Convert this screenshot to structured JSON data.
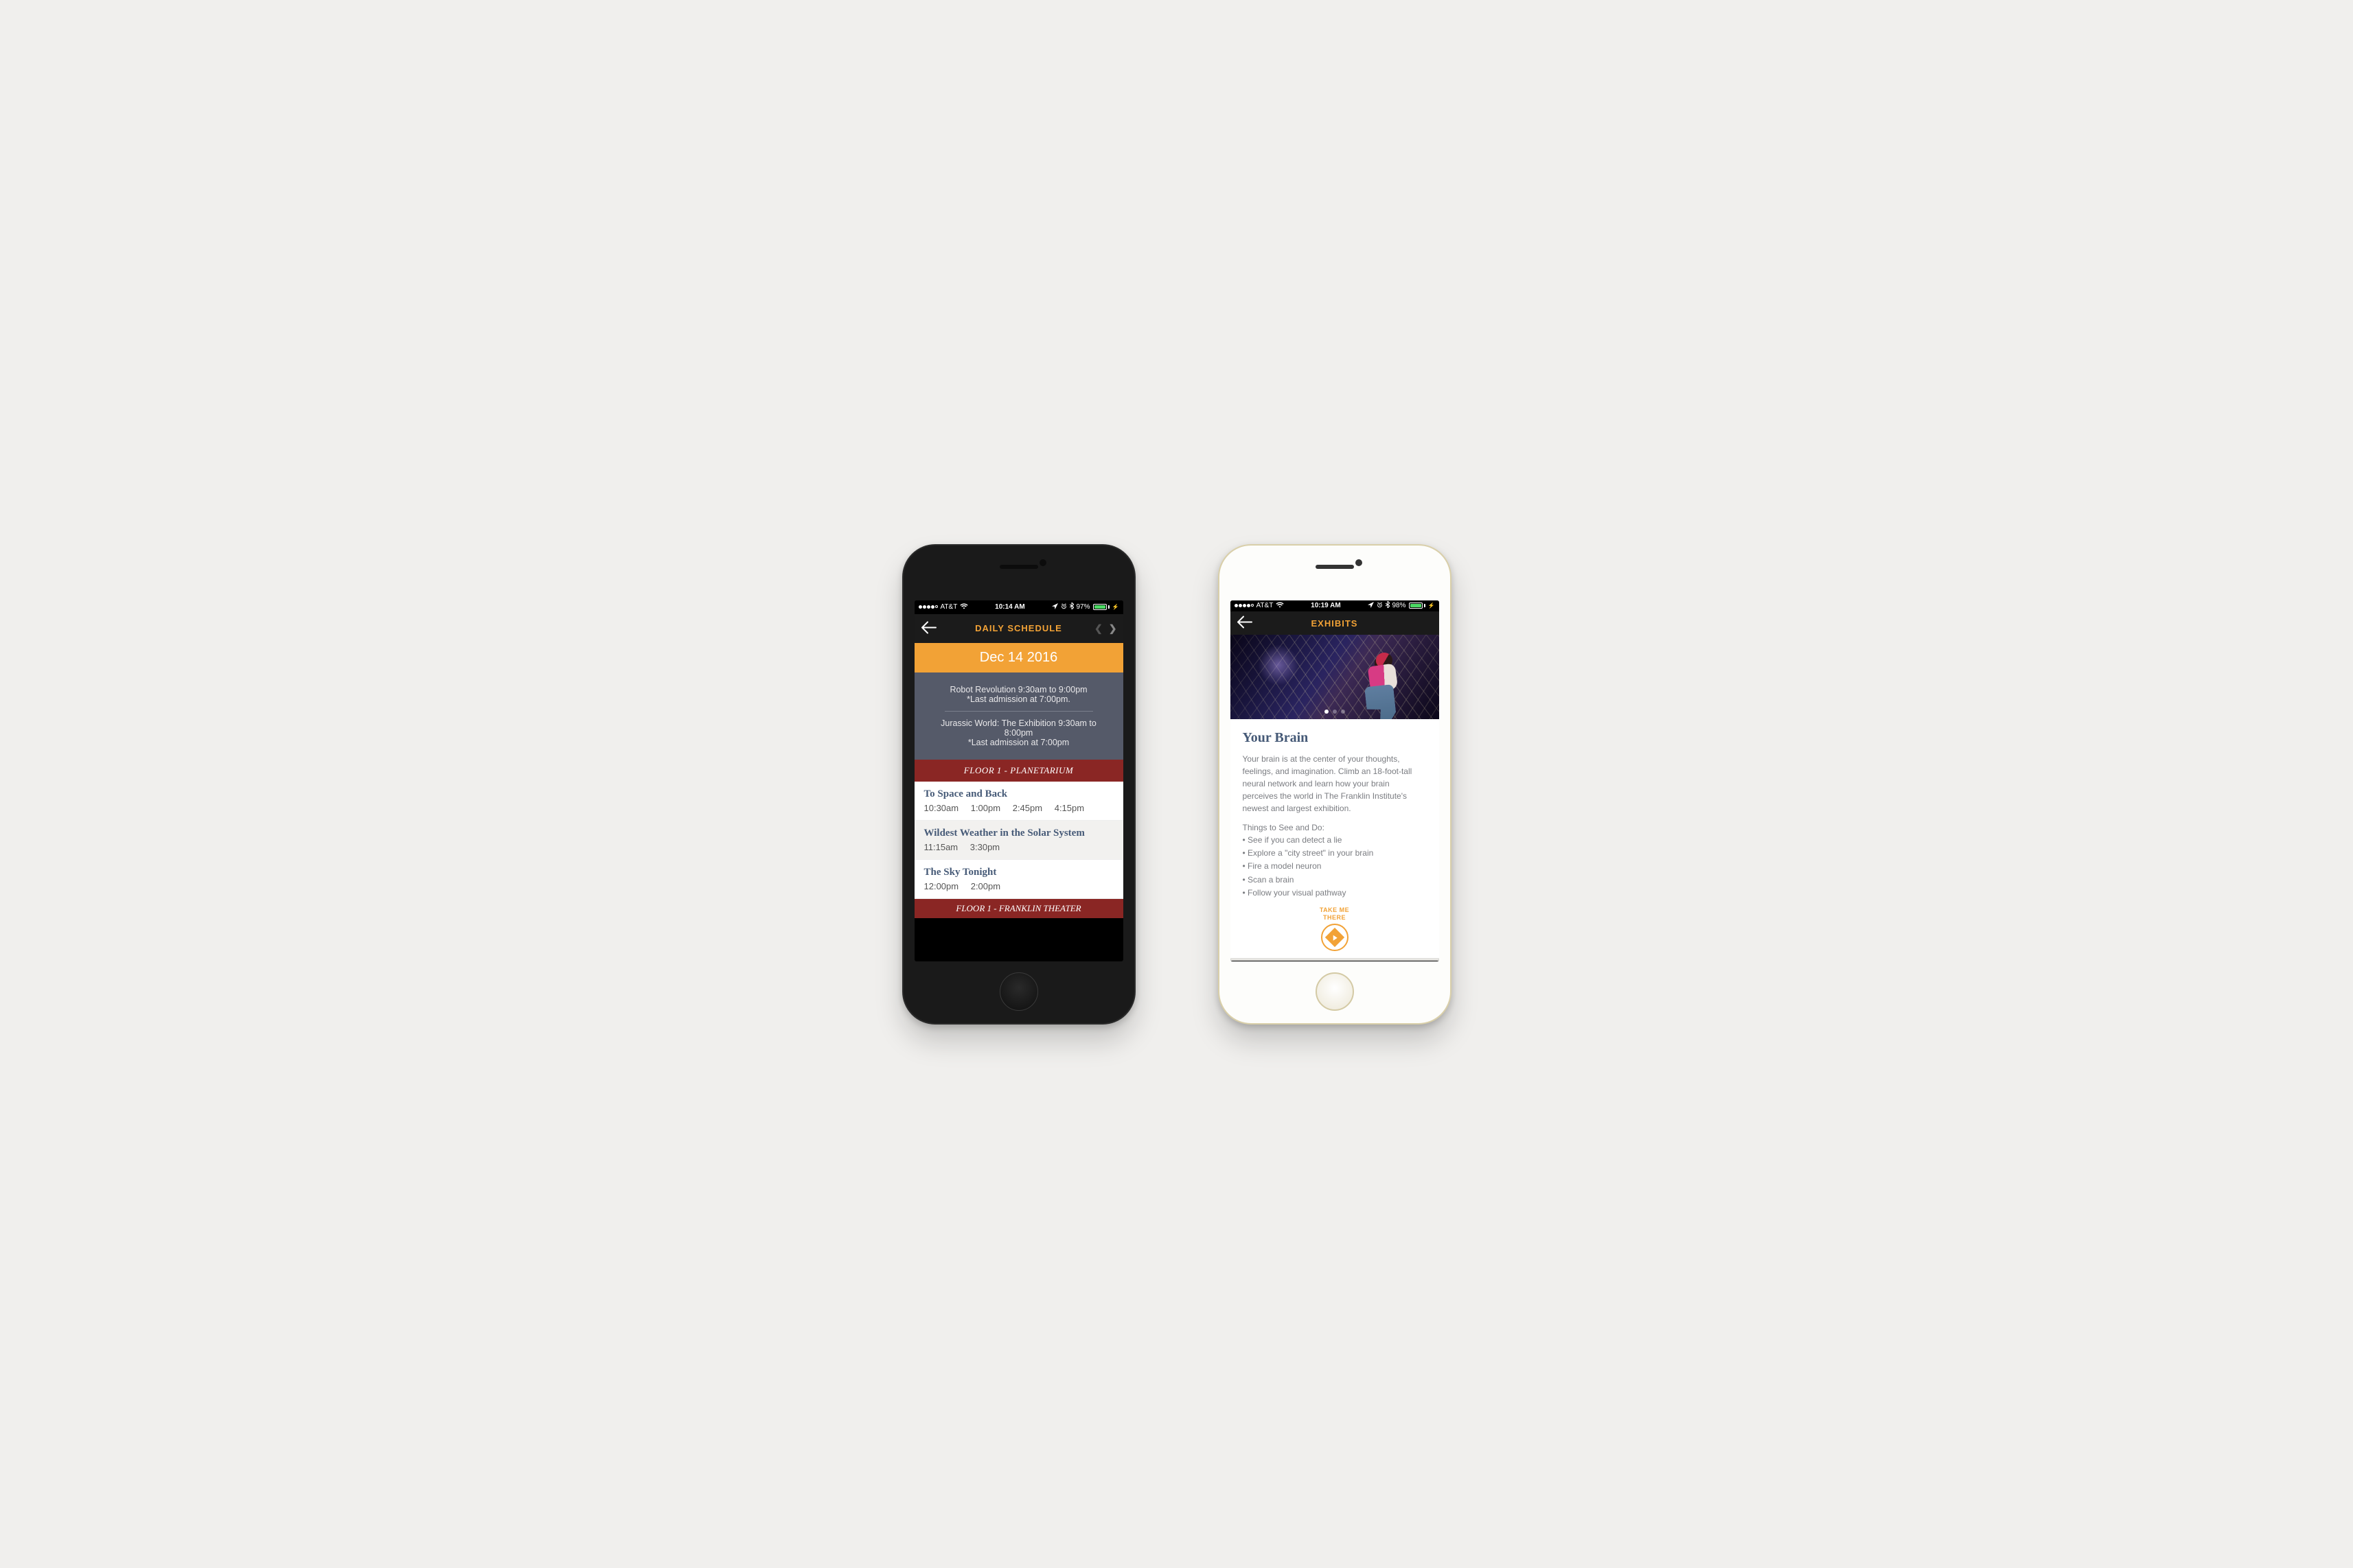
{
  "left": {
    "status": {
      "carrier": "AT&T",
      "time": "10:14 AM",
      "battery_pct": "97%"
    },
    "header": {
      "title": "DAILY SCHEDULE"
    },
    "datebar": {
      "date": "Dec 14 2016"
    },
    "featured": [
      {
        "line1": "Robot Revolution 9:30am to 9:00pm",
        "line2": "*Last admission at 7:00pm."
      },
      {
        "line1": "Jurassic World: The Exhibition 9:30am to 8:00pm",
        "line2": "*Last admission at 7:00pm"
      }
    ],
    "sections": [
      {
        "header": "FLOOR 1 - PLANETARIUM",
        "shows": [
          {
            "title": "To Space and Back",
            "times": [
              "10:30am",
              "1:00pm",
              "2:45pm",
              "4:15pm"
            ]
          },
          {
            "title": "Wildest Weather in the Solar System",
            "times": [
              "11:15am",
              "3:30pm"
            ]
          },
          {
            "title": "The Sky Tonight",
            "times": [
              "12:00pm",
              "2:00pm"
            ]
          }
        ]
      },
      {
        "header": "FLOOR 1 - FRANKLIN THEATER",
        "shows": []
      }
    ]
  },
  "right": {
    "status": {
      "carrier": "AT&T",
      "time": "10:19 AM",
      "battery_pct": "98%"
    },
    "header": {
      "title": "EXHIBITS"
    },
    "exhibit": {
      "title": "Your Brain",
      "description": "Your brain is at the center of your thoughts, feelings, and imagination. Climb an 18-foot-tall neural network and learn how your brain perceives the world in The Franklin Institute's newest and largest exhibition.",
      "things_header": "Things to See and Do:",
      "things": [
        "See if you can detect a lie",
        "Explore a \"city street\" in your brain",
        "Fire a model neuron",
        "Scan a brain",
        "Follow your visual pathway"
      ],
      "cta_line1": "TAKE ME",
      "cta_line2": "THERE"
    }
  }
}
